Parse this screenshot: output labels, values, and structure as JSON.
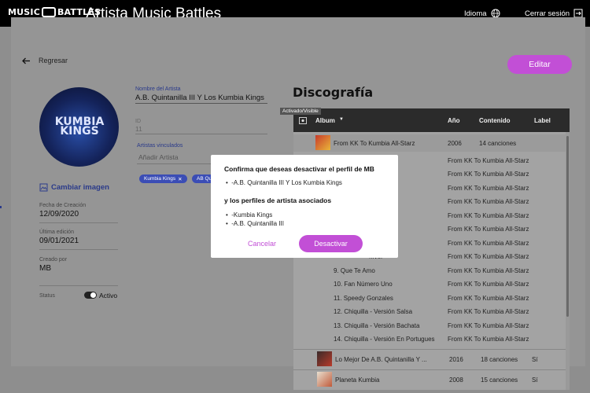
{
  "header": {
    "logo_left": "MUSIC",
    "logo_right": "BATTLES",
    "title": "Artista Music Battles",
    "language_label": "Idioma",
    "logout_label": "Cerrar sesión"
  },
  "page": {
    "back_label": "Regresar",
    "edit_label": "Editar"
  },
  "artist_card": {
    "avatar_text": "KUMBIA KINGS",
    "change_image_label": "Cambiar imagen",
    "created_date_label": "Fecha de Creación",
    "created_date": "12/09/2020",
    "last_edit_label": "Última edición",
    "last_edit": "09/01/2021",
    "created_by_label": "Creado por",
    "created_by": "MB",
    "status_label": "Status",
    "status_value": "Activo"
  },
  "form": {
    "artist_name_label": "Nombre del Artista",
    "artist_name": "A.B. Quintanilla III Y Los Kumbia Kings",
    "id_label": "ID",
    "id_value": "11",
    "linked_label": "Artistas vinculados",
    "linked_placeholder": "Añadir Artista",
    "chips": [
      "Kumbia Kings",
      "AB Qu..."
    ]
  },
  "discography": {
    "title": "Discografía",
    "tooltip": "Activado/Visible",
    "columns": {
      "album": "Album",
      "year": "Año",
      "content": "Contenido",
      "label": "Label"
    },
    "albums": [
      {
        "name": "From KK To Kumbia All-Starz",
        "year": "2006",
        "content": "14 canciones",
        "label": ""
      },
      {
        "name": "Lo Mejor De A.B. Quintanilla Y ...",
        "year": "2016",
        "content": "18 canciones",
        "label": "Sí"
      },
      {
        "name": "Planeta Kumbia",
        "year": "2008",
        "content": "15 canciones",
        "label": "Sí"
      }
    ],
    "tracks": [
      {
        "name": "",
        "album": "From KK To Kumbia All-Starz"
      },
      {
        "name": "",
        "album": "From KK To Kumbia All-Starz"
      },
      {
        "name": "",
        "album": "From KK To Kumbia All-Starz"
      },
      {
        "name": "",
        "album": "From KK To Kumbia All-Starz"
      },
      {
        "name": "",
        "album": "From KK To Kumbia All-Starz"
      },
      {
        "name": "",
        "album": "From KK To Kumbia All-Starz"
      },
      {
        "name": "",
        "album": "From KK To Kumbia All-Starz"
      },
      {
        "name": "...ver",
        "album": "From KK To Kumbia All-Starz"
      },
      {
        "name": "9. Que Te Amo",
        "album": "From KK To Kumbia All-Starz"
      },
      {
        "name": "10. Fan Número Uno",
        "album": "From KK To Kumbia All-Starz"
      },
      {
        "name": "11. Speedy Gonzales",
        "album": "From KK To Kumbia All-Starz"
      },
      {
        "name": "12. Chiquilla - Versión Salsa",
        "album": "From KK To Kumbia All-Starz"
      },
      {
        "name": "13. Chiquilla - Versión Bachata",
        "album": "From KK To Kumbia All-Starz"
      },
      {
        "name": "14. Chiquilla - Versión En Portugues",
        "album": "From KK To Kumbia All-Starz"
      }
    ]
  },
  "modal": {
    "question": "Confirma que deseas desactivar el perfil de MB",
    "profile_item": "-A.B. Quintanilla III Y Los Kumbia Kings",
    "associated_heading": "y los perfiles de artista asociados",
    "associated_items": [
      "-Kumbia Kings",
      "-A.B. Quintanilla III"
    ],
    "cancel_label": "Cancelar",
    "confirm_label": "Desactivar"
  }
}
